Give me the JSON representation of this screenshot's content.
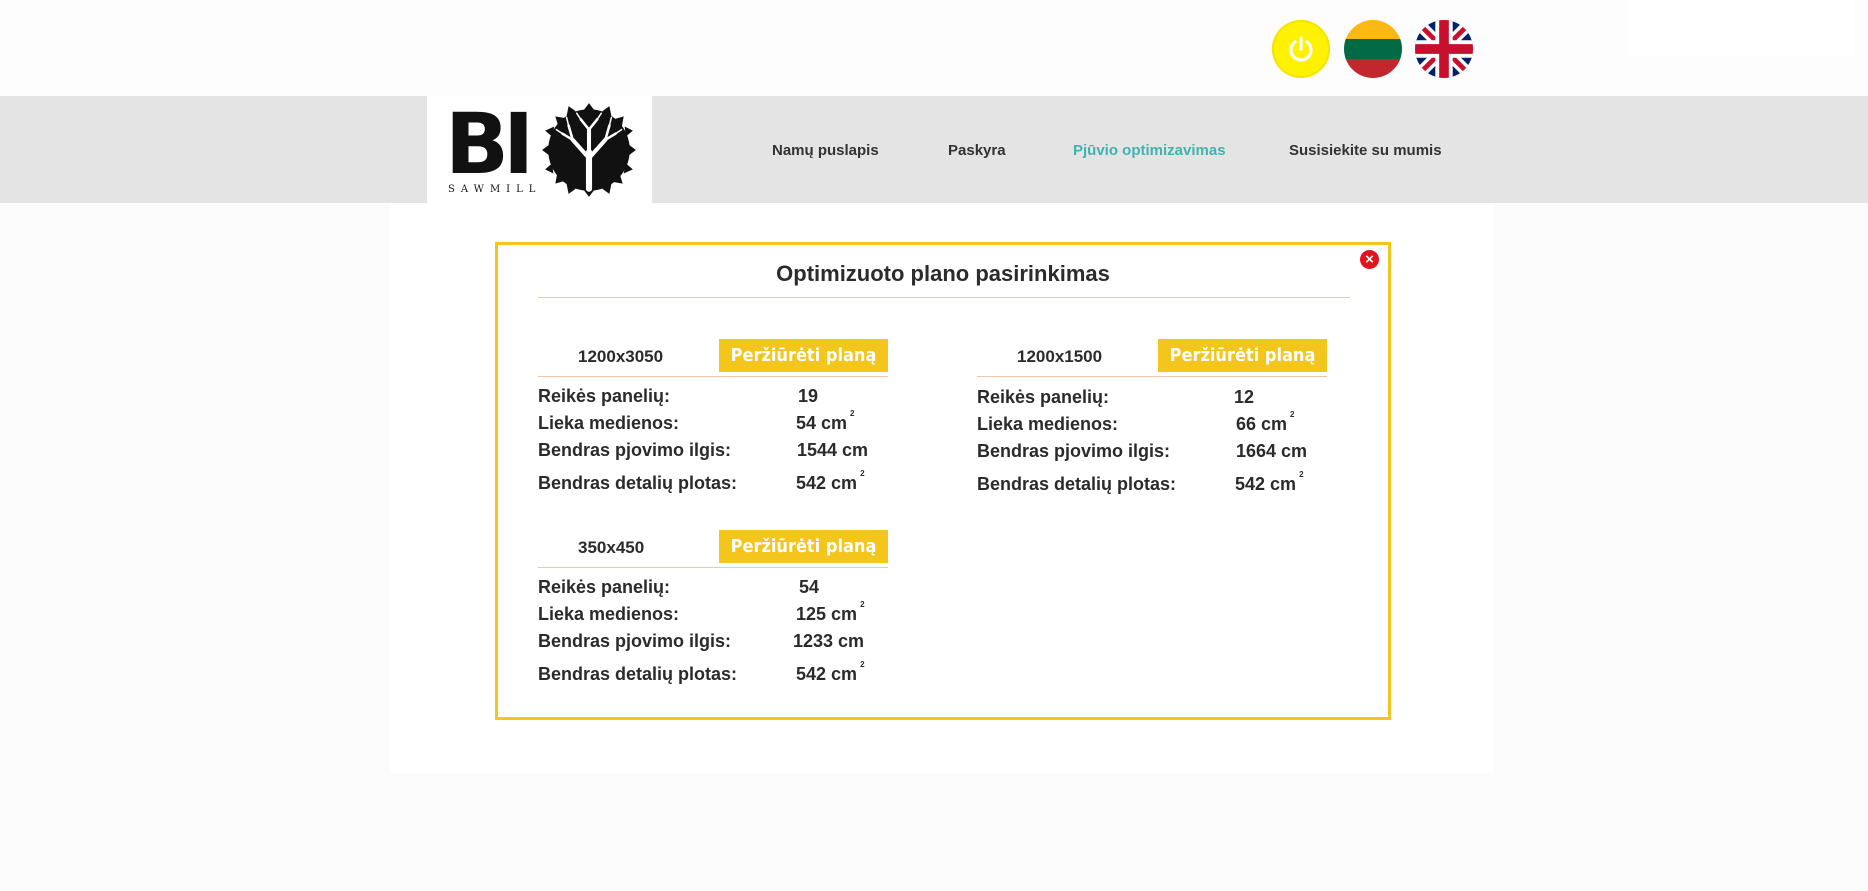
{
  "header": {
    "power_label": "power",
    "languages": [
      {
        "code": "lt",
        "name": "Lithuanian flag"
      },
      {
        "code": "en",
        "name": "UK flag"
      }
    ],
    "logo_text": "BI",
    "logo_sub": "SAWMILL"
  },
  "nav": {
    "items": [
      {
        "label": "Namų puslapis",
        "active": false
      },
      {
        "label": "Paskyra",
        "active": false
      },
      {
        "label": "Pjūvio optimizavimas",
        "active": true
      },
      {
        "label": "Susisiekite su mumis",
        "active": false
      }
    ]
  },
  "modal": {
    "title": "Optimizuoto plano pasirinkimas",
    "close_icon": "×",
    "view_button_label": "Peržiūrėti planą",
    "labels": {
      "panels": "Reikės panelių:",
      "waste": "Lieka medienos:",
      "cut_length": "Bendras pjovimo ilgis:",
      "detail_area": "Bendras detalių plotas:"
    },
    "plans": [
      {
        "size": "1200x3050",
        "panels": "19",
        "waste": "54 cm",
        "cut_length": "1544 cm",
        "detail_area": "542 cm"
      },
      {
        "size": "1200x1500",
        "panels": "12",
        "waste": "66 cm",
        "cut_length": "1664 cm",
        "detail_area": "542 cm"
      },
      {
        "size": "350x450",
        "panels": "54",
        "waste": "125 cm",
        "cut_length": "1233 cm",
        "detail_area": "542 cm"
      }
    ],
    "area_unit_sup": "2"
  }
}
